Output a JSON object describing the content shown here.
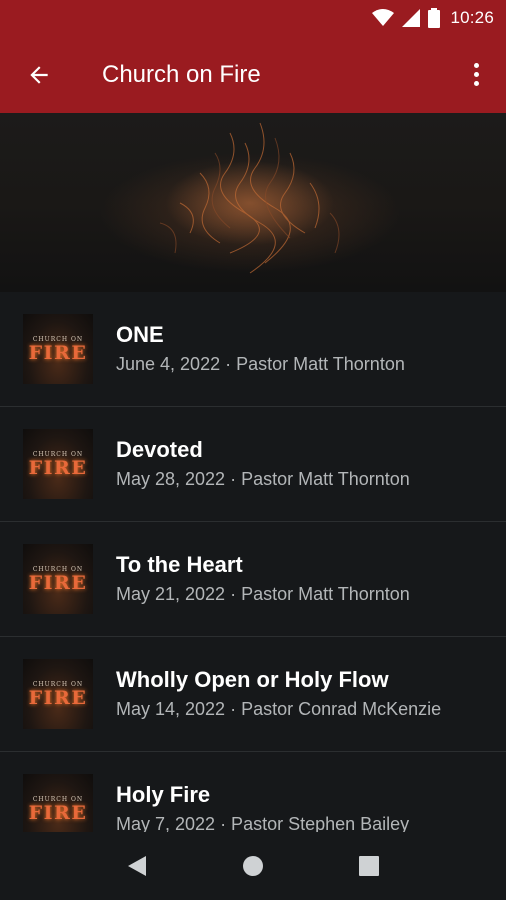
{
  "status_bar": {
    "time": "10:26"
  },
  "app_bar": {
    "title": "Church on Fire"
  },
  "thumbnail": {
    "top_text": "CHURCH ON",
    "bottom_text": "FIRE"
  },
  "sermons": [
    {
      "title": "ONE",
      "meta": "June 4, 2022 · Pastor Matt Thornton"
    },
    {
      "title": "Devoted",
      "meta": "May 28, 2022 · Pastor Matt Thornton"
    },
    {
      "title": "To the Heart",
      "meta": "May 21, 2022 · Pastor Matt Thornton"
    },
    {
      "title": "Wholly Open or Holy Flow",
      "meta": "May 14, 2022 · Pastor Conrad McKenzie"
    },
    {
      "title": "Holy Fire",
      "meta": "May 7, 2022 · Pastor Stephen Bailey"
    }
  ],
  "colors": {
    "primary": "#9a1b20",
    "background": "#16181a",
    "text_secondary": "#b3b6b8",
    "accent_fire": "#e8693a"
  }
}
